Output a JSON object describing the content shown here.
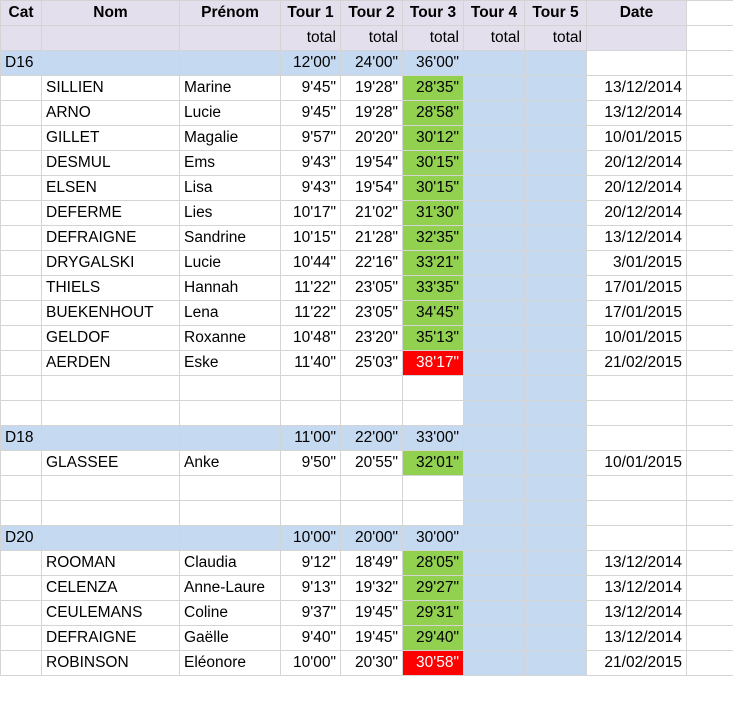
{
  "header": {
    "cat": "Cat",
    "nom": "Nom",
    "prenom": "Prénom",
    "tour1": "Tour 1",
    "tour2": "Tour 2",
    "tour3": "Tour 3",
    "tour4": "Tour 4",
    "tour5": "Tour 5",
    "date": "Date"
  },
  "subheader": {
    "total": "total"
  },
  "groups": [
    {
      "category": "D16",
      "targets": {
        "t1": "12'00\"",
        "t2": "24'00\"",
        "t3": "36'00\""
      },
      "rows": [
        {
          "nom": "SILLIEN",
          "prenom": "Marine",
          "t1": "9'45\"",
          "t2": "19'28\"",
          "t3": "28'35\"",
          "date": "13/12/2014"
        },
        {
          "nom": "ARNO",
          "prenom": "Lucie",
          "t1": "9'45\"",
          "t2": "19'28\"",
          "t3": "28'58\"",
          "date": "13/12/2014"
        },
        {
          "nom": "GILLET",
          "prenom": "Magalie",
          "t1": "9'57\"",
          "t2": "20'20\"",
          "t3": "30'12\"",
          "date": "10/01/2015"
        },
        {
          "nom": "DESMUL",
          "prenom": "Ems",
          "t1": "9'43\"",
          "t2": "19'54\"",
          "t3": "30'15\"",
          "date": "20/12/2014"
        },
        {
          "nom": "ELSEN",
          "prenom": "Lisa",
          "t1": "9'43\"",
          "t2": "19'54\"",
          "t3": "30'15\"",
          "date": "20/12/2014"
        },
        {
          "nom": "DEFERME",
          "prenom": "Lies",
          "t1": "10'17\"",
          "t2": "21'02\"",
          "t3": "31'30\"",
          "date": "20/12/2014"
        },
        {
          "nom": "DEFRAIGNE",
          "prenom": "Sandrine",
          "t1": "10'15\"",
          "t2": "21'28\"",
          "t3": "32'35\"",
          "date": "13/12/2014"
        },
        {
          "nom": "DRYGALSKI",
          "prenom": "Lucie",
          "t1": "10'44\"",
          "t2": "22'16\"",
          "t3": "33'21\"",
          "date": "3/01/2015"
        },
        {
          "nom": "THIELS",
          "prenom": "Hannah",
          "t1": "11'22\"",
          "t2": "23'05\"",
          "t3": "33'35\"",
          "date": "17/01/2015"
        },
        {
          "nom": "BUEKENHOUT",
          "prenom": "Lena",
          "t1": "11'22\"",
          "t2": "23'05\"",
          "t3": "34'45\"",
          "date": "17/01/2015"
        },
        {
          "nom": "GELDOF",
          "prenom": "Roxanne",
          "t1": "10'48\"",
          "t2": "23'20\"",
          "t3": "35'13\"",
          "date": "10/01/2015"
        },
        {
          "nom": "AERDEN",
          "prenom": "Eske",
          "t1": "11'40\"",
          "t2": "25'03\"",
          "t3": "38'17\"",
          "date": "21/02/2015"
        }
      ]
    },
    {
      "category": "D18",
      "targets": {
        "t1": "11'00\"",
        "t2": "22'00\"",
        "t3": "33'00\""
      },
      "rows": [
        {
          "nom": "GLASSEE",
          "prenom": "Anke",
          "t1": "9'50\"",
          "t2": "20'55\"",
          "t3": "32'01\"",
          "date": "10/01/2015"
        }
      ]
    },
    {
      "category": "D20",
      "targets": {
        "t1": "10'00\"",
        "t2": "20'00\"",
        "t3": "30'00\""
      },
      "rows": [
        {
          "nom": "ROOMAN",
          "prenom": "Claudia",
          "t1": "9'12\"",
          "t2": "18'49\"",
          "t3": "28'05\"",
          "date": "13/12/2014"
        },
        {
          "nom": "CELENZA",
          "prenom": "Anne-Laure",
          "t1": "9'13\"",
          "t2": "19'32\"",
          "t3": "29'27\"",
          "date": "13/12/2014"
        },
        {
          "nom": "CEULEMANS",
          "prenom": "Coline",
          "t1": "9'37\"",
          "t2": "19'45\"",
          "t3": "29'31\"",
          "date": "13/12/2014"
        },
        {
          "nom": "DEFRAIGNE",
          "prenom": "Gaëlle",
          "t1": "9'40\"",
          "t2": "19'45\"",
          "t3": "29'40\"",
          "date": "13/12/2014"
        },
        {
          "nom": "ROBINSON",
          "prenom": "Eléonore",
          "t1": "10'00\"",
          "t2": "20'30\"",
          "t3": "30'58\"",
          "date": "21/02/2015"
        }
      ]
    }
  ],
  "colors": {
    "header_bg": "#e4dfec",
    "category_bg": "#c5d9f1",
    "t3_pass": "#92d050",
    "t3_fail": "#ff0000"
  }
}
